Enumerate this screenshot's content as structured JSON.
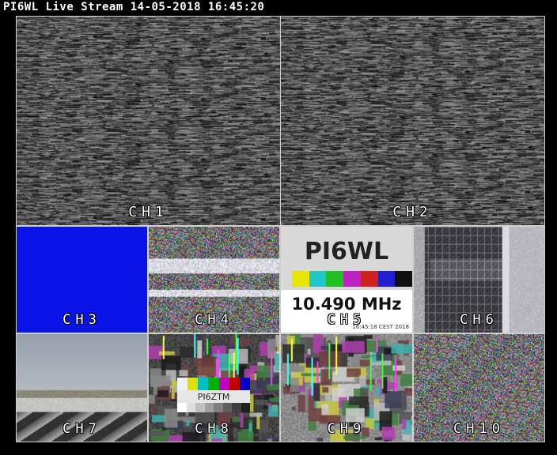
{
  "stream": {
    "station": "PI6WL",
    "title": "PI6WL Live Stream 14-05-2018 16:45:20"
  },
  "channels": [
    {
      "id": "CH1",
      "label": "CH1",
      "content": "noise"
    },
    {
      "id": "CH2",
      "label": "CH2",
      "content": "noise"
    },
    {
      "id": "CH3",
      "label": "CH3",
      "content": "solid-blue"
    },
    {
      "id": "CH4",
      "label": "CH4",
      "content": "color-noise"
    },
    {
      "id": "CH5",
      "label": "CH5",
      "content": "testcard"
    },
    {
      "id": "CH6",
      "label": "CH6",
      "content": "building-camera"
    },
    {
      "id": "CH7",
      "label": "CH7",
      "content": "rooftop-camera"
    },
    {
      "id": "CH8",
      "label": "CH8",
      "content": "testcard-glitch"
    },
    {
      "id": "CH9",
      "label": "CH9",
      "content": "pixelated-glitch"
    },
    {
      "id": "CH10",
      "label": "CH10",
      "content": "color-noise"
    }
  ],
  "ch5_testcard": {
    "callsign": "PI6WL",
    "frequency": "10.490 MHz",
    "timestamp": "16:45:18 CEST 2018",
    "color_bars": [
      "#e6e600",
      "#1ec8c8",
      "#20c020",
      "#c020c0",
      "#d02020",
      "#2020d0",
      "#101010"
    ]
  },
  "ch8_testcard": {
    "callsign": "PI6ZTM",
    "color_bars": [
      "#f0f0f0",
      "#e0e000",
      "#00c0c0",
      "#00b000",
      "#c000c0",
      "#c00000",
      "#0000c0"
    ]
  },
  "colors": {
    "background": "#000000",
    "title_text": "#ffffff",
    "tile_border": "#cfcfcf",
    "ch3_blue": "#0a14e6"
  }
}
